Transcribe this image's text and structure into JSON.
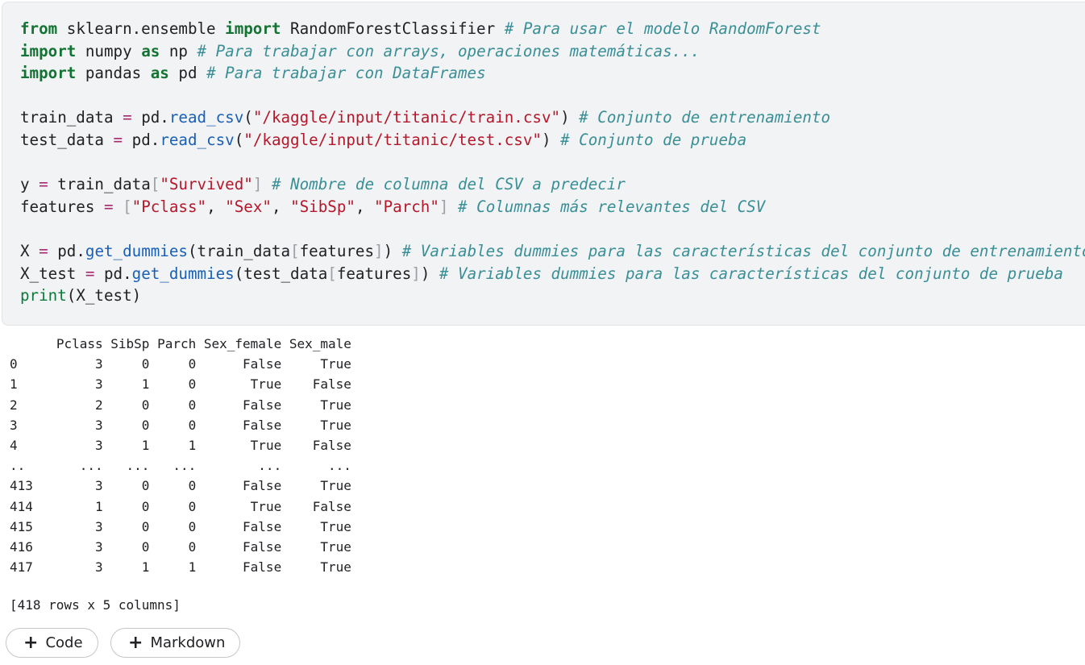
{
  "code_cell": {
    "lines": [
      [
        {
          "t": "kw",
          "v": "from"
        },
        {
          "t": "tx",
          "v": " sklearn.ensemble "
        },
        {
          "t": "kw",
          "v": "import"
        },
        {
          "t": "tx",
          "v": " RandomForestClassifier "
        },
        {
          "t": "cm",
          "v": "# Para usar el modelo RandomForest"
        }
      ],
      [
        {
          "t": "kw",
          "v": "import"
        },
        {
          "t": "tx",
          "v": " numpy "
        },
        {
          "t": "kw",
          "v": "as"
        },
        {
          "t": "tx",
          "v": " np "
        },
        {
          "t": "cm",
          "v": "# Para trabajar con arrays, operaciones matemáticas..."
        }
      ],
      [
        {
          "t": "kw",
          "v": "import"
        },
        {
          "t": "tx",
          "v": " pandas "
        },
        {
          "t": "kw",
          "v": "as"
        },
        {
          "t": "tx",
          "v": " pd "
        },
        {
          "t": "cm",
          "v": "# Para trabajar con DataFrames"
        }
      ],
      [],
      [
        {
          "t": "tx",
          "v": "train_data "
        },
        {
          "t": "op",
          "v": "="
        },
        {
          "t": "tx",
          "v": " pd."
        },
        {
          "t": "fn",
          "v": "read_csv"
        },
        {
          "t": "tx",
          "v": "("
        },
        {
          "t": "st",
          "v": "\"/kaggle/input/titanic/train.csv\""
        },
        {
          "t": "tx",
          "v": ") "
        },
        {
          "t": "cm",
          "v": "# Conjunto de entrenamiento"
        }
      ],
      [
        {
          "t": "tx",
          "v": "test_data "
        },
        {
          "t": "op",
          "v": "="
        },
        {
          "t": "tx",
          "v": " pd."
        },
        {
          "t": "fn",
          "v": "read_csv"
        },
        {
          "t": "tx",
          "v": "("
        },
        {
          "t": "st",
          "v": "\"/kaggle/input/titanic/test.csv\""
        },
        {
          "t": "tx",
          "v": ") "
        },
        {
          "t": "cm",
          "v": "# Conjunto de prueba"
        }
      ],
      [],
      [
        {
          "t": "tx",
          "v": "y "
        },
        {
          "t": "op",
          "v": "="
        },
        {
          "t": "tx",
          "v": " train_data"
        },
        {
          "t": "br",
          "v": "["
        },
        {
          "t": "st",
          "v": "\"Survived\""
        },
        {
          "t": "br",
          "v": "]"
        },
        {
          "t": "tx",
          "v": " "
        },
        {
          "t": "cm",
          "v": "# Nombre de columna del CSV a predecir"
        }
      ],
      [
        {
          "t": "tx",
          "v": "features "
        },
        {
          "t": "op",
          "v": "="
        },
        {
          "t": "tx",
          "v": " "
        },
        {
          "t": "br",
          "v": "["
        },
        {
          "t": "st",
          "v": "\"Pclass\""
        },
        {
          "t": "tx",
          "v": ", "
        },
        {
          "t": "st",
          "v": "\"Sex\""
        },
        {
          "t": "tx",
          "v": ", "
        },
        {
          "t": "st",
          "v": "\"SibSp\""
        },
        {
          "t": "tx",
          "v": ", "
        },
        {
          "t": "st",
          "v": "\"Parch\""
        },
        {
          "t": "br",
          "v": "]"
        },
        {
          "t": "tx",
          "v": " "
        },
        {
          "t": "cm",
          "v": "# Columnas más relevantes del CSV"
        }
      ],
      [],
      [
        {
          "t": "tx",
          "v": "X "
        },
        {
          "t": "op",
          "v": "="
        },
        {
          "t": "tx",
          "v": " pd."
        },
        {
          "t": "fn",
          "v": "get_dummies"
        },
        {
          "t": "tx",
          "v": "(train_data"
        },
        {
          "t": "br",
          "v": "["
        },
        {
          "t": "tx",
          "v": "features"
        },
        {
          "t": "br",
          "v": "]"
        },
        {
          "t": "tx",
          "v": ") "
        },
        {
          "t": "cm",
          "v": "# Variables dummies para las características del conjunto de entrenamiento"
        }
      ],
      [
        {
          "t": "tx",
          "v": "X_test "
        },
        {
          "t": "op",
          "v": "="
        },
        {
          "t": "tx",
          "v": " pd."
        },
        {
          "t": "fn",
          "v": "get_dummies"
        },
        {
          "t": "tx",
          "v": "(test_data"
        },
        {
          "t": "br",
          "v": "["
        },
        {
          "t": "tx",
          "v": "features"
        },
        {
          "t": "br",
          "v": "]"
        },
        {
          "t": "tx",
          "v": ") "
        },
        {
          "t": "cm",
          "v": "# Variables dummies para las características del conjunto de prueba"
        }
      ],
      [
        {
          "t": "bi",
          "v": "print"
        },
        {
          "t": "tx",
          "v": "(X_test)"
        }
      ]
    ]
  },
  "output": {
    "columns": [
      "",
      "Pclass",
      "SibSp",
      "Parch",
      "Sex_female",
      "Sex_male"
    ],
    "rows": [
      [
        "0",
        "3",
        "0",
        "0",
        "False",
        "True"
      ],
      [
        "1",
        "3",
        "1",
        "0",
        "True",
        "False"
      ],
      [
        "2",
        "2",
        "0",
        "0",
        "False",
        "True"
      ],
      [
        "3",
        "3",
        "0",
        "0",
        "False",
        "True"
      ],
      [
        "4",
        "3",
        "1",
        "1",
        "True",
        "False"
      ],
      [
        "..",
        "...",
        "...",
        "...",
        "...",
        "..."
      ],
      [
        "413",
        "3",
        "0",
        "0",
        "False",
        "True"
      ],
      [
        "414",
        "1",
        "0",
        "0",
        "True",
        "False"
      ],
      [
        "415",
        "3",
        "0",
        "0",
        "False",
        "True"
      ],
      [
        "416",
        "3",
        "0",
        "0",
        "False",
        "True"
      ],
      [
        "417",
        "3",
        "1",
        "1",
        "False",
        "True"
      ]
    ],
    "summary": "[418 rows x 5 columns]"
  },
  "buttons": {
    "add_code_label": "Code",
    "add_markdown_label": "Markdown",
    "plus_glyph": "+"
  },
  "colors": {
    "cell_background": "#f1f3f4",
    "keyword": "#137333",
    "comment": "#3a8f97",
    "string": "#b5182b",
    "function": "#1a5fb4"
  }
}
